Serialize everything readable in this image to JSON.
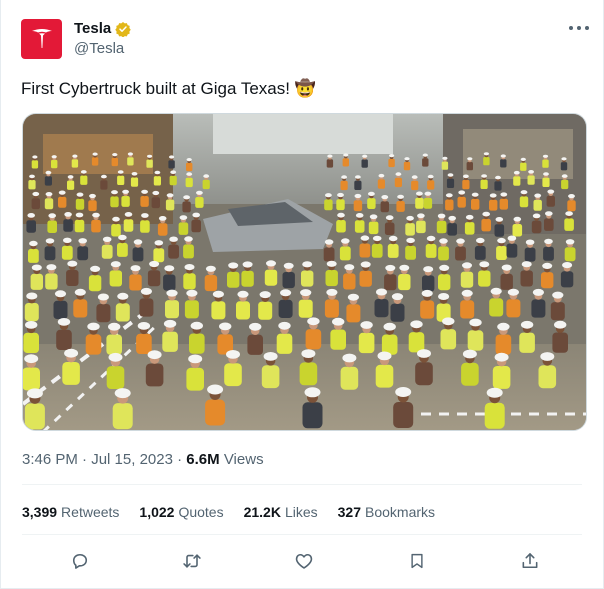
{
  "author": {
    "name": "Tesla",
    "handle": "@Tesla",
    "verified": true,
    "avatar_icon": "tesla-logo-icon",
    "avatar_color": "#e31937",
    "verified_color": "#e2b719"
  },
  "menu": {
    "icon": "more-horizontal-icon"
  },
  "tweet": {
    "text": "First Cybertruck built at Giga Texas!",
    "emoji": "🤠",
    "image_alt": "Group photo of workers in hard hats and safety vests around the first Cybertruck at Giga Texas"
  },
  "meta": {
    "time": "3:46 PM",
    "sep1": " · ",
    "date": "Jul 15, 2023",
    "sep2": " · ",
    "views_count": "6.6M",
    "views_label": " Views"
  },
  "stats": [
    {
      "count": "3,399",
      "label": "Retweets"
    },
    {
      "count": "1,022",
      "label": "Quotes"
    },
    {
      "count": "21.2K",
      "label": "Likes"
    },
    {
      "count": "327",
      "label": "Bookmarks"
    }
  ],
  "actions": [
    {
      "icon": "reply-icon"
    },
    {
      "icon": "retweet-icon"
    },
    {
      "icon": "like-icon"
    },
    {
      "icon": "bookmark-icon"
    },
    {
      "icon": "share-icon"
    }
  ],
  "colors": {
    "text_primary": "#0f1419",
    "text_secondary": "#536471",
    "divider": "#eff3f4"
  }
}
